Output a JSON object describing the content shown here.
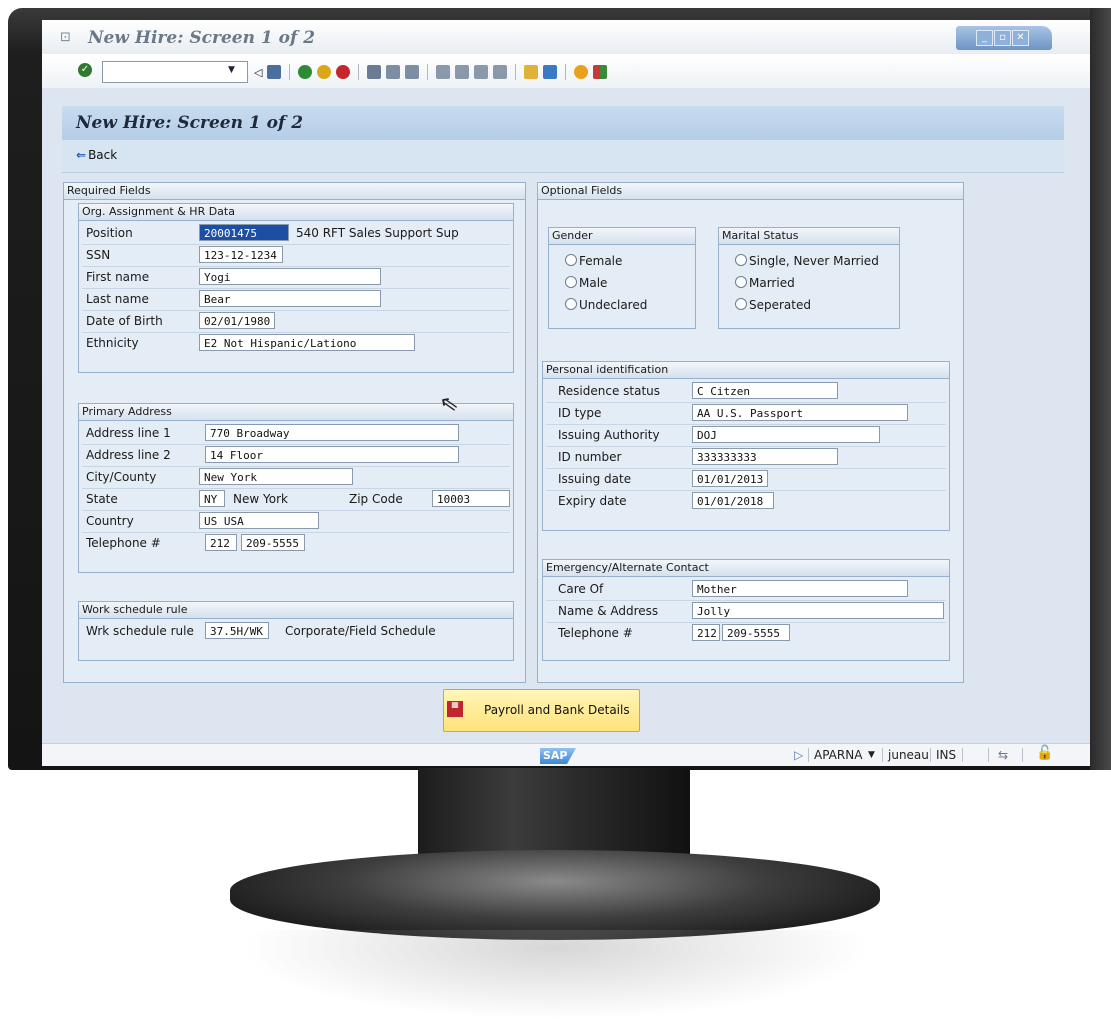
{
  "window": {
    "title": "New Hire: Screen 1 of 2",
    "controls": [
      "_",
      "▫",
      "✕"
    ]
  },
  "toolbar": {
    "command_field_value": "",
    "icons": [
      "ok-check-icon",
      "back-triangle-icon",
      "save-icon",
      "back-green-icon",
      "exit-yellow-icon",
      "cancel-red-icon",
      "print-icon",
      "find-icon",
      "find-next-icon",
      "first-page-icon",
      "prev-page-icon",
      "next-page-icon",
      "last-page-icon",
      "new-session-icon",
      "shortcut-icon",
      "help-icon",
      "customize-layout-icon"
    ]
  },
  "screen_header": {
    "title": "New Hire: Screen 1 of 2",
    "back_label": "Back"
  },
  "required": {
    "title": "Required Fields",
    "org": {
      "title": "Org. Assignment & HR Data",
      "position_label": "Position",
      "position_value": "20001475",
      "position_desc": "540 RFT Sales Support Sup",
      "ssn_label": "SSN",
      "ssn_value": "123-12-1234",
      "first_name_label": "First name",
      "first_name_value": "Yogi",
      "last_name_label": "Last name",
      "last_name_value": "Bear",
      "dob_label": "Date of Birth",
      "dob_value": "02/01/1980",
      "ethnicity_label": "Ethnicity",
      "ethnicity_value": "E2 Not Hispanic/Lationo"
    },
    "address": {
      "title": "Primary Address",
      "line1_label": "Address line 1",
      "line1_value": "770 Broadway",
      "line2_label": "Address line 2",
      "line2_value": "14 Floor",
      "city_label": "City/County",
      "city_value": "New York",
      "state_label": "State",
      "state_code": "NY",
      "state_name": "New York",
      "zip_label": "Zip Code",
      "zip_value": "10003",
      "country_label": "Country",
      "country_value": "US USA",
      "phone_label": "Telephone #",
      "phone_area": "212",
      "phone_number": "209-5555"
    },
    "work": {
      "title": "Work schedule rule",
      "rule_label": "Wrk schedule rule",
      "rule_value": "37.5H/WK",
      "rule_desc": "Corporate/Field Schedule"
    }
  },
  "optional": {
    "title": "Optional Fields",
    "gender": {
      "title": "Gender",
      "options": [
        "Female",
        "Male",
        "Undeclared"
      ]
    },
    "marital": {
      "title": "Marital Status",
      "options": [
        "Single, Never Married",
        "Married",
        "Seperated"
      ]
    },
    "personal_id": {
      "title": "Personal identification",
      "residence_label": "Residence status",
      "residence_value": "C Citzen",
      "id_type_label": "ID type",
      "id_type_value": "AA U.S. Passport",
      "authority_label": "Issuing Authority",
      "authority_value": "DOJ",
      "id_number_label": "ID number",
      "id_number_value": "333333333",
      "issuing_date_label": "Issuing date",
      "issuing_date_value": "01/01/2013",
      "expiry_label": "Expiry date",
      "expiry_value": "01/01/2018"
    },
    "emergency": {
      "title": "Emergency/Alternate Contact",
      "care_of_label": "Care Of",
      "care_of_value": "Mother",
      "name_address_label": "Name & Address",
      "name_address_value": "Jolly",
      "phone_label": "Telephone #",
      "phone_area": "212",
      "phone_number": "209-5555"
    }
  },
  "payroll_button": {
    "label": "Payroll and Bank Details"
  },
  "status_bar": {
    "logo": "SAP",
    "system": "APARNA",
    "server": "juneau",
    "mode": "INS"
  }
}
